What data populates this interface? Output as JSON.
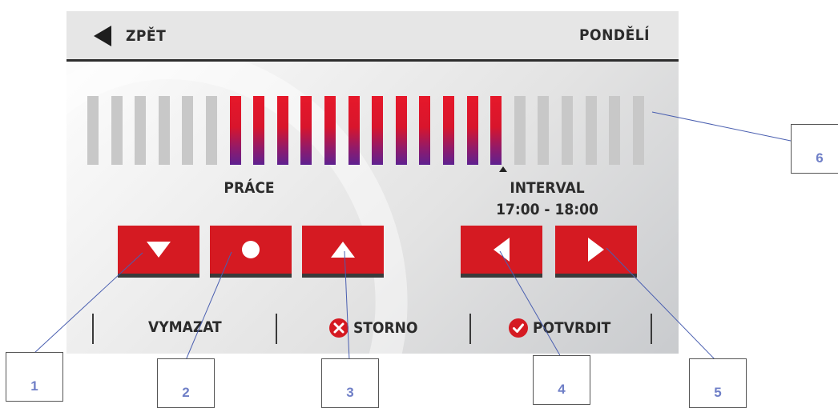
{
  "header": {
    "back_label": "ZPĚT",
    "day": "PONDĚLÍ"
  },
  "schedule": {
    "slots": [
      0,
      0,
      0,
      0,
      0,
      0,
      1,
      1,
      1,
      1,
      1,
      1,
      1,
      1,
      1,
      1,
      1,
      1,
      0,
      0,
      0,
      0,
      0,
      0
    ],
    "mode_label": "PRÁCE",
    "interval_label": "INTERVAL",
    "interval_time": "17:00 - 18:00"
  },
  "controls": [
    "down-arrow",
    "circle",
    "up-arrow",
    "left-arrow",
    "right-arrow"
  ],
  "footer": {
    "delete_label": "VYMAZAT",
    "cancel_label": "STORNO",
    "confirm_label": "POTVRDIT"
  },
  "callouts": [
    "1",
    "2",
    "3",
    "4",
    "5",
    "6"
  ],
  "colors": {
    "accent": "#d51a22",
    "bar_off": "#c8c8c8",
    "bar_on_bottom": "#5e2190",
    "callout_text": "#6f7fc7"
  }
}
